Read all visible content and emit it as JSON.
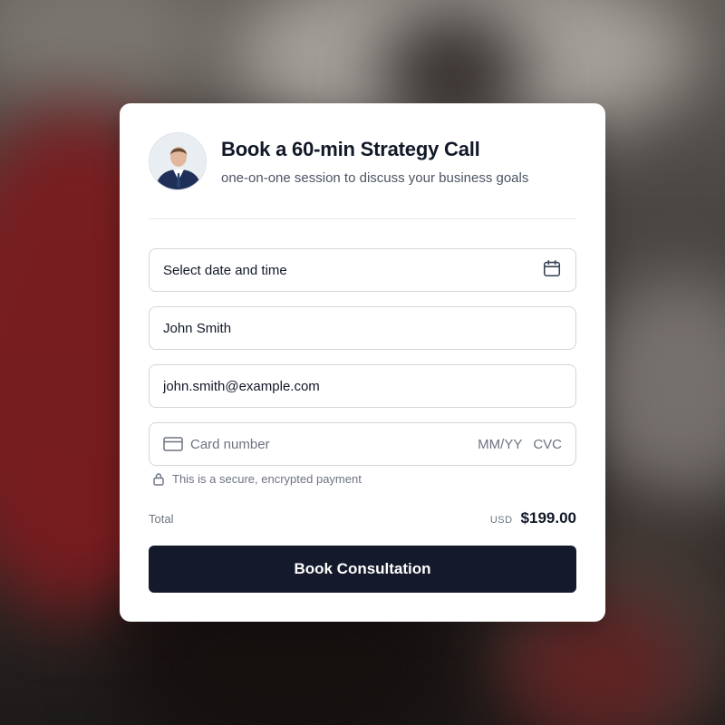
{
  "booking": {
    "title": "Book a 60-min Strategy Call",
    "subtitle": "one-on-one session to discuss your business goals",
    "avatar_icon": "person-avatar"
  },
  "form": {
    "date_placeholder": "Select date and time",
    "date_icon": "calendar-icon",
    "name_value": "John Smith",
    "email_value": "john.smith@example.com",
    "card_placeholder": "Card number",
    "card_icon": "credit-card-icon",
    "expiry_placeholder": "MM/YY",
    "cvc_placeholder": "CVC",
    "secure_text": "This is a secure, encrypted payment",
    "secure_icon": "lock-icon"
  },
  "total": {
    "label": "Total",
    "currency": "USD",
    "amount": "$199.00"
  },
  "actions": {
    "book_label": "Book Consultation"
  },
  "colors": {
    "button_bg": "#141a2b",
    "card_bg": "#ffffff"
  }
}
